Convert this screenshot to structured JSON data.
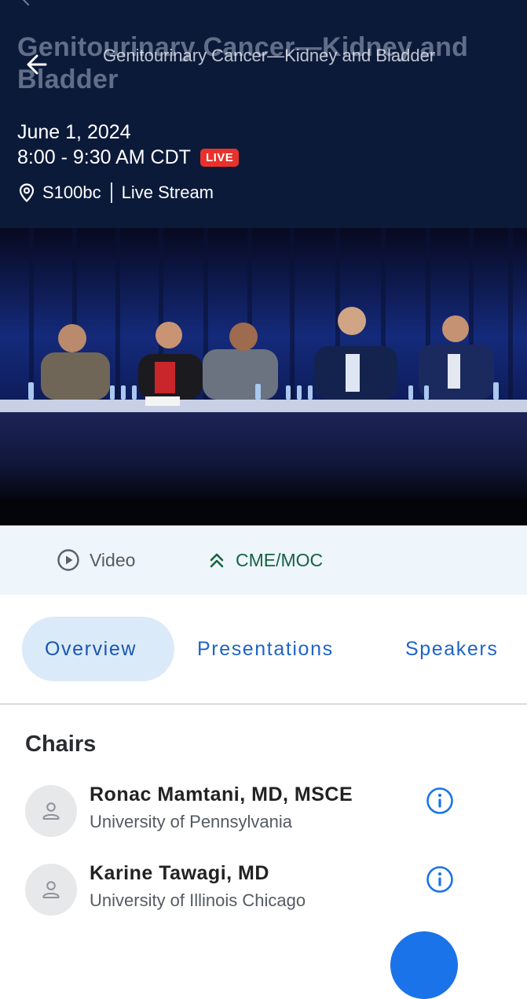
{
  "header": {
    "title_overlay": "Genitourinary Cancer—Kidney and Bladder",
    "title": "Genitourinary Cancer—Kidney and Bladder",
    "date": "June 1, 2024",
    "time": "8:00 - 9:30 AM CDT",
    "live_badge": "LIVE",
    "room": "S100bc",
    "stream": "Live Stream"
  },
  "media_tabs": {
    "video_label": "Video",
    "cme_label": "CME/MOC"
  },
  "tabs": [
    {
      "label": "Overview",
      "active": true
    },
    {
      "label": "Presentations",
      "active": false
    },
    {
      "label": "Speakers",
      "active": false
    }
  ],
  "chairs": {
    "heading": "Chairs",
    "people": [
      {
        "name": "Ronac Mamtani, MD, MSCE",
        "affiliation": "University of Pennsylvania"
      },
      {
        "name": "Karine Tawagi, MD",
        "affiliation": "University of Illinois Chicago"
      }
    ]
  },
  "icons": {
    "back": "arrow-left-icon",
    "location": "location-pin-icon",
    "video": "play-circle-icon",
    "cme": "double-chevron-up-icon",
    "avatar": "person-icon",
    "info": "info-icon"
  },
  "colors": {
    "header_bg": "#0c1a3a",
    "live_badge": "#e8322b",
    "accent_blue": "#1e64c8",
    "cme_green": "#17623f"
  }
}
